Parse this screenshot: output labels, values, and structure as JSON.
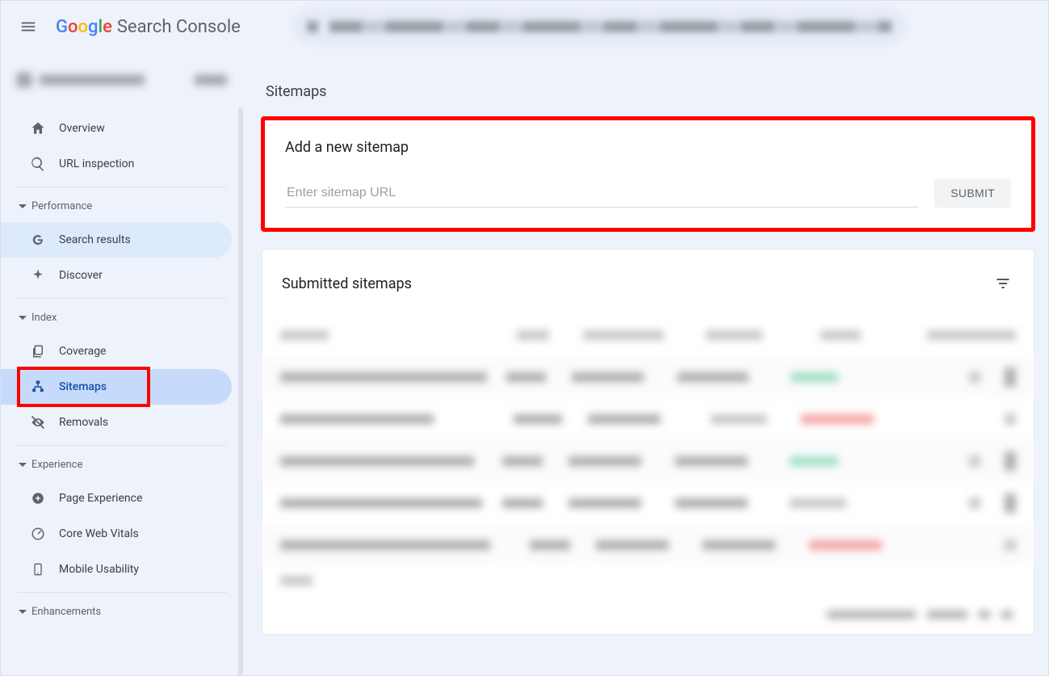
{
  "header": {
    "product_name": "Search Console"
  },
  "sidebar": {
    "items": {
      "overview": "Overview",
      "url_inspection": "URL inspection",
      "search_results": "Search results",
      "discover": "Discover",
      "coverage": "Coverage",
      "sitemaps": "Sitemaps",
      "removals": "Removals",
      "page_experience": "Page Experience",
      "core_web_vitals": "Core Web Vitals",
      "mobile_usability": "Mobile Usability"
    },
    "sections": {
      "performance": "Performance",
      "index": "Index",
      "experience": "Experience",
      "enhancements": "Enhancements"
    }
  },
  "main": {
    "page_title": "Sitemaps",
    "add_card": {
      "title": "Add a new sitemap",
      "placeholder": "Enter sitemap URL",
      "submit": "SUBMIT"
    },
    "list_card": {
      "title": "Submitted sitemaps"
    }
  }
}
